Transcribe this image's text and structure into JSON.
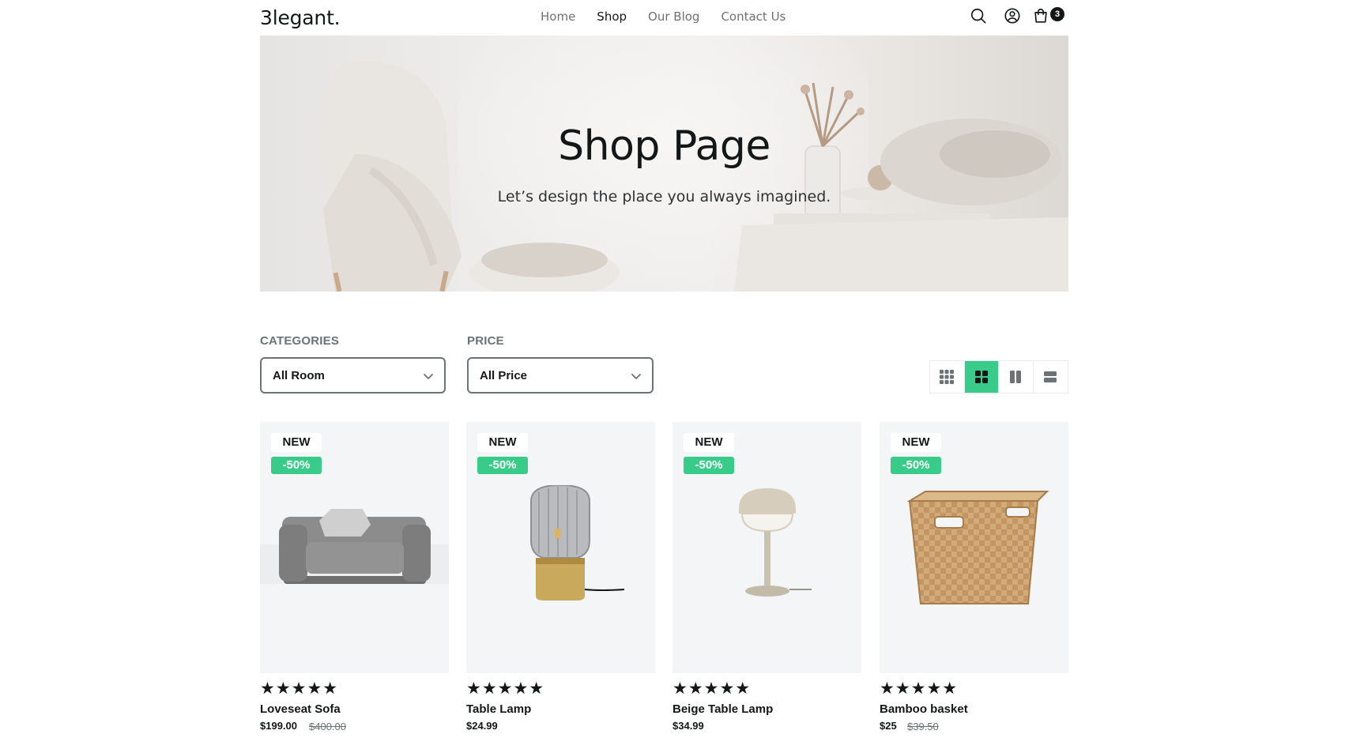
{
  "header": {
    "logo": "3legant.",
    "nav": [
      "Home",
      "Shop",
      "Our Blog",
      "Contact Us"
    ],
    "active_nav": "Shop",
    "cart_count": "3"
  },
  "hero": {
    "title": "Shop Page",
    "subtitle": "Let’s design the place you always imagined."
  },
  "filters": {
    "categories_label": "CATEGORIES",
    "categories_value": "All Room",
    "price_label": "PRICE",
    "price_value": "All Price",
    "active_view": "grid-2x2"
  },
  "colors": {
    "accent": "#38cb89",
    "text": "#141718",
    "muted": "#6c7275",
    "card_bg": "#f3f5f7"
  },
  "products": [
    {
      "badge_new": "NEW",
      "badge_discount": "-50%",
      "rating": "★★★★★",
      "name": "Loveseat Sofa",
      "price": "$199.00",
      "old_price": "$400.00"
    },
    {
      "badge_new": "NEW",
      "badge_discount": "-50%",
      "rating": "★★★★★",
      "name": "Table Lamp",
      "price": "$24.99",
      "old_price": ""
    },
    {
      "badge_new": "NEW",
      "badge_discount": "-50%",
      "rating": "★★★★★",
      "name": "Beige Table Lamp",
      "price": "$34.99",
      "old_price": ""
    },
    {
      "badge_new": "NEW",
      "badge_discount": "-50%",
      "rating": "★★★★★",
      "name": "Bamboo basket",
      "price": "$25",
      "old_price": "$39.50"
    }
  ]
}
